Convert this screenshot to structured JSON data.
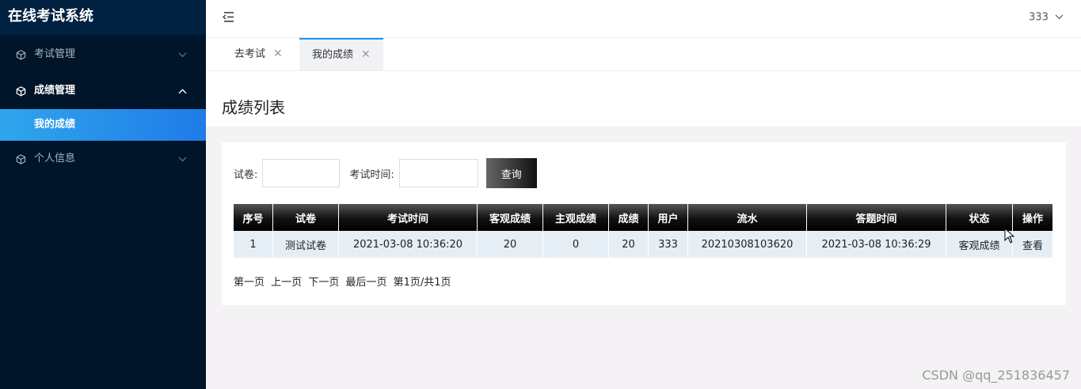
{
  "app": {
    "title": "在线考试系统"
  },
  "sidebar": {
    "items": [
      {
        "label": "考试管理",
        "icon": "cube-icon",
        "state": "collapsed"
      },
      {
        "label": "成绩管理",
        "icon": "cube-icon",
        "state": "expanded",
        "children": [
          {
            "label": "我的成绩",
            "active": true
          }
        ]
      },
      {
        "label": "个人信息",
        "icon": "cube-icon",
        "state": "collapsed"
      }
    ]
  },
  "header": {
    "menu_fold_icon": "menu-fold-icon",
    "user": "333"
  },
  "tabs": [
    {
      "label": "去考试",
      "active": false
    },
    {
      "label": "我的成绩",
      "active": true
    }
  ],
  "page": {
    "title": "成绩列表"
  },
  "search": {
    "paper_label": "试卷:",
    "paper_value": "",
    "time_label": "考试时间:",
    "time_value": "",
    "button": "查询"
  },
  "table": {
    "columns": [
      "序号",
      "试卷",
      "考试时间",
      "客观成绩",
      "主观成绩",
      "成绩",
      "用户",
      "流水",
      "答题时间",
      "状态",
      "操作"
    ],
    "rows": [
      [
        "1",
        "测试试卷",
        "2021-03-08 10:36:20",
        "20",
        "0",
        "20",
        "333",
        "20210308103620",
        "2021-03-08 10:36:29",
        "客观成绩",
        "查看"
      ]
    ]
  },
  "pager": {
    "first": "第一页",
    "prev": "上一页",
    "next": "下一页",
    "last": "最后一页",
    "info": "第1页/共1页"
  },
  "watermark": "CSDN @qq_251836457",
  "colors": {
    "sidebar_bg": "#001529",
    "active_item": "#1f7be8",
    "header_bg": "#ffffff"
  }
}
